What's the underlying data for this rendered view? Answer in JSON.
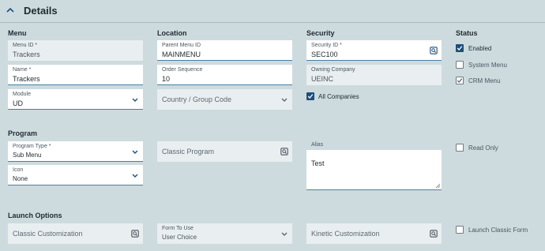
{
  "header": {
    "title": "Details"
  },
  "sections": {
    "menu": "Menu",
    "location": "Location",
    "security": "Security",
    "status": "Status",
    "program": "Program",
    "launch": "Launch Options"
  },
  "fields": {
    "menu_id": {
      "label": "Menu ID *",
      "value": "Trackers"
    },
    "name": {
      "label": "Name *",
      "value": "Trackers"
    },
    "module": {
      "label": "Module",
      "value": "UD"
    },
    "parent_menu_id": {
      "label": "Parent Menu ID",
      "value": "MAINMENU"
    },
    "order_sequence": {
      "label": "Order Sequence",
      "value": "10"
    },
    "country_group": {
      "placeholder": "Country / Group Code"
    },
    "security_id": {
      "label": "Security ID *",
      "value": "SEC100"
    },
    "owning_company": {
      "label": "Owning Company",
      "value": "UEINC"
    },
    "all_companies": {
      "label": "All Companies",
      "checked": true
    },
    "program_type": {
      "label": "Program Type *",
      "value": "Sub Menu"
    },
    "icon": {
      "label": "Icon",
      "value": "None"
    },
    "classic_program": {
      "placeholder": "Classic Program"
    },
    "alias": {
      "label": "Alias",
      "value": "Test"
    },
    "classic_customization": {
      "placeholder": "Classic Customization"
    },
    "form_to_use": {
      "label": "Form To Use",
      "value": "User Choice"
    },
    "kinetic_customization": {
      "placeholder": "Kinetic Customization"
    }
  },
  "status": {
    "enabled": {
      "label": "Enabled",
      "checked": true
    },
    "system_menu": {
      "label": "System Menu",
      "checked": false
    },
    "crm_menu": {
      "label": "CRM Menu",
      "checked": true
    },
    "read_only": {
      "label": "Read Only",
      "checked": false
    },
    "launch_classic_form": {
      "label": "Launch Classic Form",
      "checked": false
    }
  },
  "colors": {
    "background": "#cddbdf",
    "accent": "#1e4f7c",
    "field_underline": "#4a7fa0"
  }
}
